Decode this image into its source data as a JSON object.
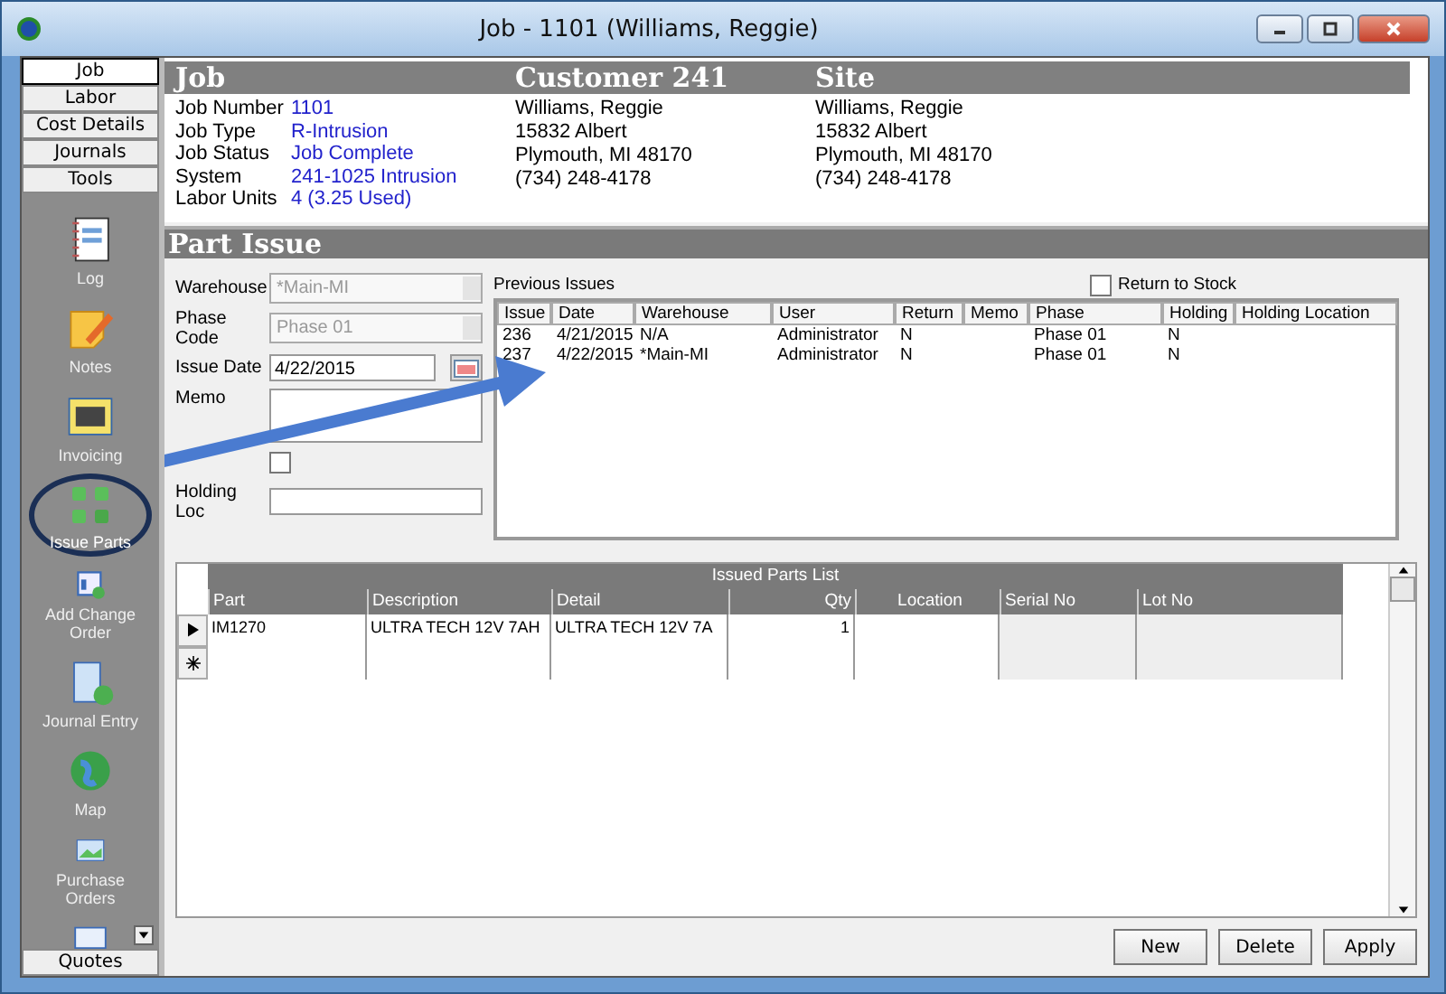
{
  "window": {
    "title": "Job - 1101 (Williams, Reggie)"
  },
  "sidebar": {
    "tabs": [
      {
        "label": "Job",
        "selected": true
      },
      {
        "label": "Labor",
        "selected": false
      },
      {
        "label": "Cost Details",
        "selected": false
      },
      {
        "label": "Journals",
        "selected": false
      },
      {
        "label": "Tools",
        "selected": false
      }
    ],
    "items": [
      {
        "label": "Log",
        "kind": "log",
        "selected": false
      },
      {
        "label": "Notes",
        "kind": "notes",
        "selected": false
      },
      {
        "label": "Invoicing",
        "kind": "invoice",
        "selected": false
      },
      {
        "label": "Issue Parts",
        "kind": "parts",
        "selected": true
      },
      {
        "label": "Add Change Order",
        "kind": "order",
        "selected": false
      },
      {
        "label": "Journal Entry",
        "kind": "journal",
        "selected": false
      },
      {
        "label": "Map",
        "kind": "map",
        "selected": false
      },
      {
        "label": "Purchase Orders",
        "kind": "purchase",
        "selected": false
      },
      {
        "kind": "doc",
        "selected": false
      }
    ],
    "bottom_tab": "Quotes"
  },
  "header": {
    "job": {
      "title": "Job",
      "fields": [
        {
          "label": "Job Number",
          "value": "1101"
        },
        {
          "label": "Job Type",
          "value": "R-Intrusion"
        },
        {
          "label": "Job Status",
          "value": "Job Complete"
        },
        {
          "label": "System",
          "value": "241-1025 Intrusion"
        },
        {
          "label": "Labor Units",
          "value": "4 (3.25 Used)"
        }
      ]
    },
    "customer": {
      "title": "Customer 241",
      "lines": [
        "Williams, Reggie",
        "15832 Albert",
        "Plymouth, MI  48170",
        "(734) 248-4178"
      ]
    },
    "site": {
      "title": "Site",
      "lines": [
        "Williams, Reggie",
        "15832 Albert",
        "Plymouth, MI  48170",
        "(734) 248-4178"
      ]
    }
  },
  "part_issue": {
    "title": "Part Issue",
    "warehouse": {
      "label": "Warehouse",
      "value": "*Main-MI",
      "disabled": true
    },
    "phase_code": {
      "label": "Phase Code",
      "value": "Phase 01",
      "disabled": true
    },
    "issue_date": {
      "label": "Issue Date",
      "value": "4/22/2015"
    },
    "memo": {
      "label": "Memo"
    },
    "holding": {
      "checked": false
    },
    "holding_loc": {
      "label": "Holding Loc"
    },
    "return_to_stock": {
      "label": "Return to Stock",
      "checked": false
    },
    "previous_issues": {
      "title": "Previous Issues",
      "columns": [
        "Issue",
        "Date",
        "Warehouse",
        "User",
        "Return",
        "Memo",
        "Phase",
        "Holding",
        "Holding Location"
      ],
      "rows": [
        [
          "236",
          "4/21/2015",
          "N/A",
          "Administrator",
          "N",
          "",
          "Phase 01",
          "N",
          ""
        ],
        [
          "237",
          "4/22/2015",
          "*Main-MI",
          "Administrator",
          "N",
          "",
          "Phase 01",
          "N",
          ""
        ]
      ]
    },
    "issued_parts": {
      "title": "Issued Parts List",
      "columns": [
        "Part",
        "Description",
        "Detail",
        "Qty",
        "Location",
        "Serial No",
        "Lot No"
      ],
      "rows": [
        {
          "cells": [
            "IM1270",
            "ULTRA TECH 12V 7AH",
            "ULTRA TECH 12V 7A",
            "1",
            "",
            "",
            ""
          ],
          "current": true
        }
      ]
    },
    "buttons": [
      "New",
      "Delete",
      "Apply"
    ]
  }
}
